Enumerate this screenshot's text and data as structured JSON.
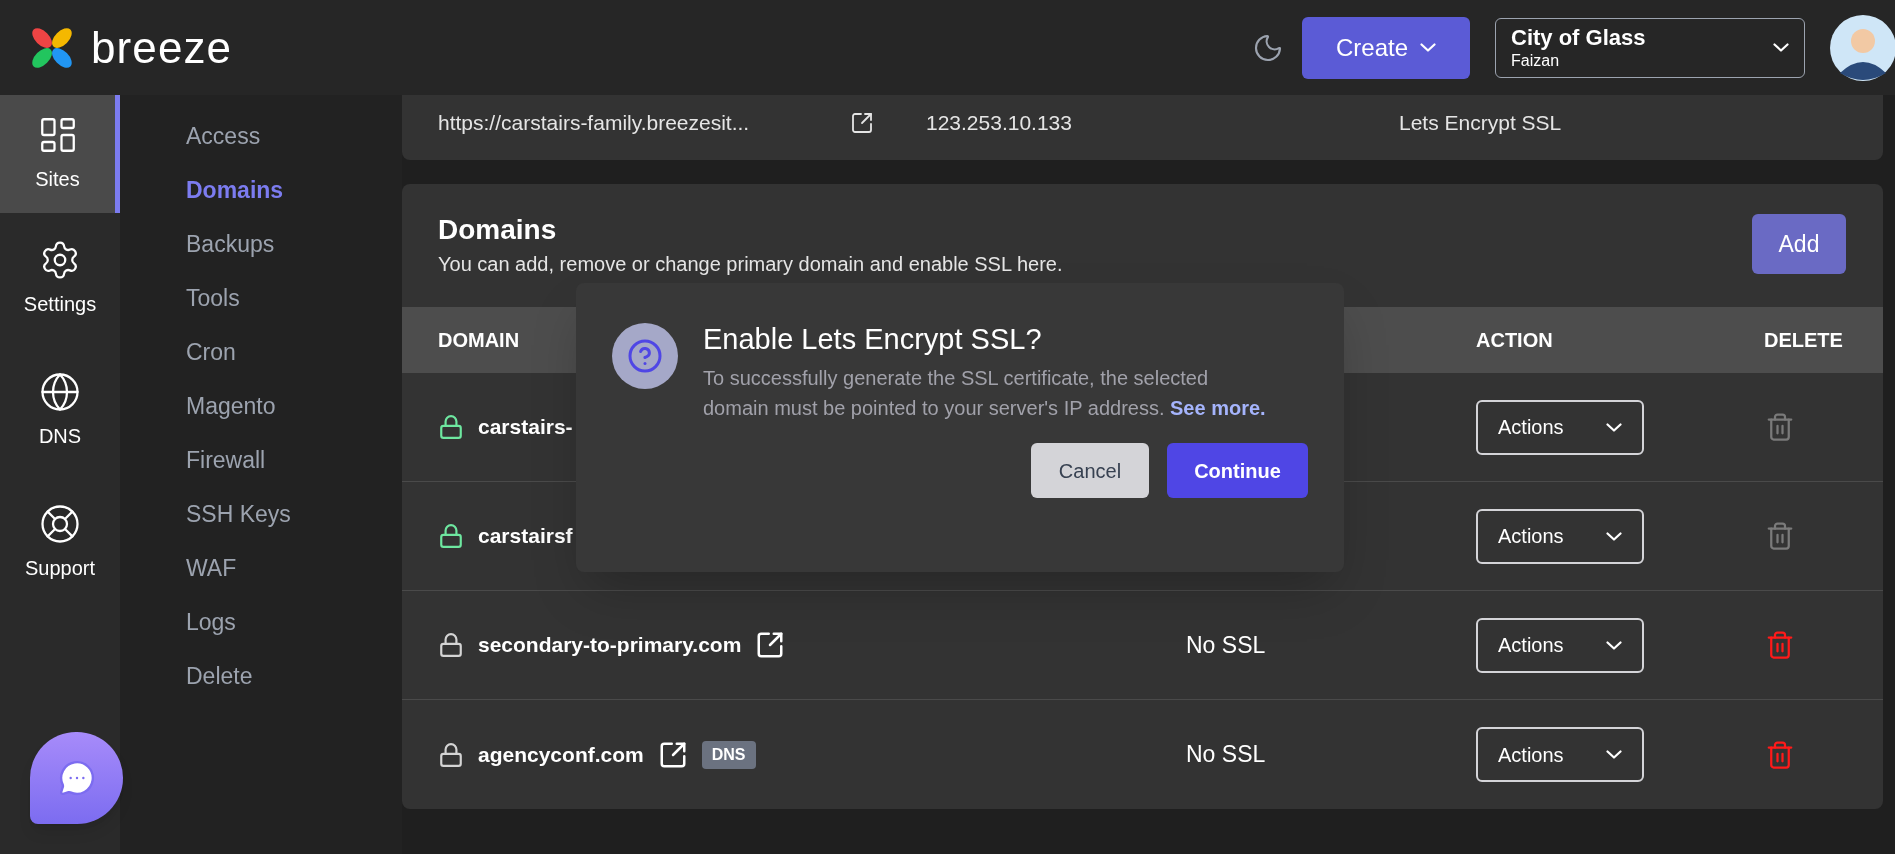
{
  "header": {
    "logo_text": "breeze",
    "create_button": "Create",
    "team": {
      "name": "City of Glass",
      "user": "Faizan"
    }
  },
  "rail": [
    {
      "label": "Sites",
      "selected": true
    },
    {
      "label": "Settings",
      "selected": false
    },
    {
      "label": "DNS",
      "selected": false
    },
    {
      "label": "Support",
      "selected": false
    }
  ],
  "submenu": [
    {
      "label": "Access",
      "selected": false
    },
    {
      "label": "Domains",
      "selected": true
    },
    {
      "label": "Backups",
      "selected": false
    },
    {
      "label": "Tools",
      "selected": false
    },
    {
      "label": "Cron",
      "selected": false
    },
    {
      "label": "Magento",
      "selected": false
    },
    {
      "label": "Firewall",
      "selected": false
    },
    {
      "label": "SSH Keys",
      "selected": false
    },
    {
      "label": "WAF",
      "selected": false
    },
    {
      "label": "Logs",
      "selected": false
    },
    {
      "label": "Delete",
      "selected": false
    }
  ],
  "site_info": {
    "url": "https://carstairs-family.breezesit...",
    "ip": "123.253.10.133",
    "ssl": "Lets Encrypt SSL"
  },
  "domains": {
    "title": "Domains",
    "subtitle": "You can add, remove or change primary domain and enable SSL here.",
    "add_button": "Add",
    "columns": [
      "DOMAIN",
      "ACTION",
      "DELETE"
    ],
    "rows": [
      {
        "domain": "carstairs-",
        "secure": true,
        "action": "Actions",
        "deletable": false
      },
      {
        "domain": "carstairsf",
        "secure": true,
        "action": "Actions",
        "deletable": false
      },
      {
        "domain": "secondary-to-primary.com",
        "secure": false,
        "external_link": true,
        "ssl": "No SSL",
        "action": "Actions",
        "deletable": true
      },
      {
        "domain": "agencyconf.com",
        "secure": false,
        "external_link": true,
        "badge": "DNS",
        "ssl": "No SSL",
        "action": "Actions",
        "deletable": true
      }
    ]
  },
  "dialog": {
    "title": "Enable Lets Encrypt SSL?",
    "message": "To successfully generate the SSL certificate, the selected domain must be pointed to your server's IP address.",
    "link": "See more.",
    "buttons": [
      {
        "label": "Cancel",
        "kind": "secondary"
      },
      {
        "label": "Continue",
        "kind": "primary"
      }
    ]
  }
}
